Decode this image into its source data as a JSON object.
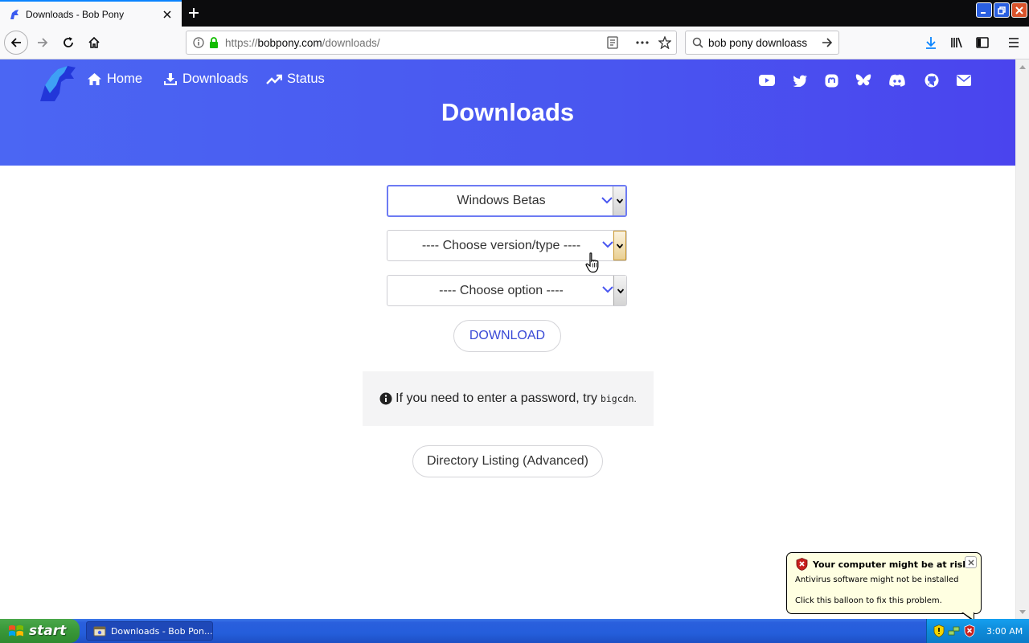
{
  "browser": {
    "tab_title": "Downloads - Bob Pony",
    "url_prefix": "https://",
    "url_host": "bobpony.com",
    "url_path": "/downloads/",
    "search_value": "bob pony downloass"
  },
  "site": {
    "nav": {
      "home_label": "Home",
      "downloads_label": "Downloads",
      "status_label": "Status"
    },
    "social_icons": [
      "youtube-icon",
      "twitter-icon",
      "mastodon-icon",
      "bluesky-icon",
      "discord-icon",
      "github-icon",
      "email-icon"
    ],
    "heading": "Downloads",
    "brand_color": "#4956f0"
  },
  "downloads": {
    "category_select": "Windows Betas",
    "version_select": "---- Choose version/type ----",
    "option_select": "---- Choose option ----",
    "download_button": "DOWNLOAD",
    "note_text": "If you need to enter a password, try",
    "note_code": "bigcdn",
    "note_end": ".",
    "directory_button": "Directory Listing (Advanced)"
  },
  "balloon": {
    "title": "Your computer might be at risk",
    "line1": "Antivirus software might not be installed",
    "line2": "Click this balloon to fix this problem."
  },
  "taskbar": {
    "start_label": "start",
    "task_label": "Downloads - Bob Pon...",
    "clock": "3:00 AM"
  }
}
